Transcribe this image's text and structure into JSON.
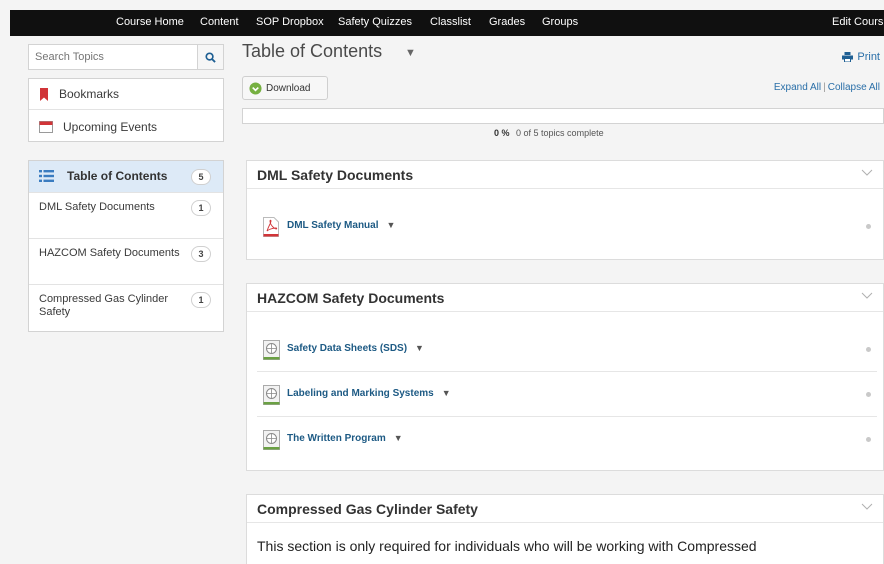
{
  "nav": {
    "items": [
      "Course Home",
      "Content",
      "SOP Dropbox",
      "Safety Quizzes",
      "Classlist",
      "Grades",
      "Groups"
    ],
    "edit_course": "Edit Cours"
  },
  "sidebar": {
    "search_placeholder": "Search Topics",
    "links": [
      {
        "label": "Bookmarks",
        "icon": "bookmark-icon"
      },
      {
        "label": "Upcoming Events",
        "icon": "calendar-icon"
      }
    ],
    "toc": {
      "label": "Table of Contents",
      "count": "5",
      "items": [
        {
          "label": "DML Safety Documents",
          "count": "1"
        },
        {
          "label": "HAZCOM Safety Documents",
          "count": "3"
        },
        {
          "label": "Compressed Gas Cylinder Safety",
          "count": "1"
        }
      ]
    }
  },
  "main": {
    "title": "Table of Contents",
    "print_label": "Print",
    "download_label": "Download",
    "expand_all": "Expand All",
    "collapse_all": "Collapse All",
    "progress": {
      "percent_label": "0 %",
      "percent": 0,
      "summary": "0 of 5 topics complete"
    },
    "modules": [
      {
        "title": "DML Safety Documents",
        "topics": [
          {
            "title": "DML Safety Manual",
            "icon": "pdf-icon"
          }
        ]
      },
      {
        "title": "HAZCOM Safety Documents",
        "topics": [
          {
            "title": "Safety Data Sheets (SDS)",
            "icon": "web-link-icon"
          },
          {
            "title": "Labeling and Marking Systems",
            "icon": "web-link-icon"
          },
          {
            "title": "The Written Program",
            "icon": "web-link-icon"
          }
        ]
      },
      {
        "title": "Compressed Gas Cylinder Safety",
        "description": "This section is only required for individuals who will be working with Compressed"
      }
    ]
  },
  "colors": {
    "nav_bg": "#101010",
    "link": "#1d5a84",
    "toc_active_bg": "#ddeaf7",
    "download_green": "#76b041"
  }
}
